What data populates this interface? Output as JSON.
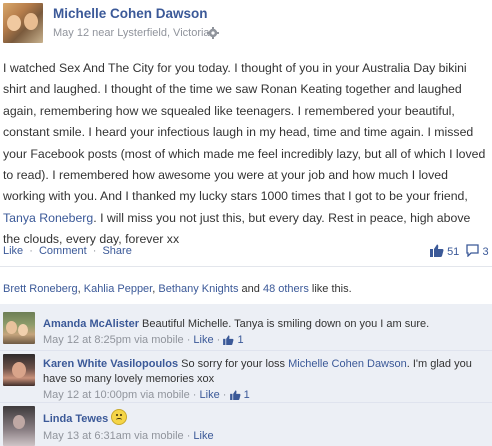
{
  "post": {
    "author": "Michelle Cohen Dawson",
    "date": "May 12",
    "location_prefix": " near ",
    "location": "Lysterfield, Victoria",
    "meta_sep": " · ",
    "privacy_icon": "gear-icon",
    "body_before_tag": "I watched Sex And The City for you today. I thought of you in your Australia Day bikini shirt and laughed. I thought of the time we saw Ronan Keating together and laughed again, remembering how we squealed like teenagers. I remembered your beautiful, constant smile. I heard your infectious laugh in my head, time and time again. I missed your Facebook posts (most of which made me feel incredibly lazy, but all of which I loved to read). I remembered how awesome you were at your job and how much I loved working with you. And I thanked my lucky stars 1000 times that I got to be your friend, ",
    "tagged": "Tanya Roneberg",
    "body_after_tag": ". I will miss you not just this, but every day. Rest in peace, high above the clouds, every day, forever xx",
    "actions": {
      "like": "Like",
      "comment": "Comment",
      "share": "Share",
      "sep": "·"
    },
    "like_count": "51",
    "comment_count": "3",
    "likers": {
      "names": [
        "Brett Roneberg",
        "Kahlia Pepper",
        "Bethany Knights"
      ],
      "and": " and ",
      "others": "48 others",
      "suffix": " like this."
    }
  },
  "comments": [
    {
      "name": "Amanda McAlister",
      "text": "Beautiful Michelle. Tanya is smiling down on you I am sure.",
      "time": "May 12 at 8:25pm via mobile",
      "like_label": "Like",
      "likes": "1"
    },
    {
      "name": "Karen White Vasilopoulos",
      "text_before": "So sorry for your loss ",
      "mention": "Michelle Cohen Dawson",
      "text_after": ". I'm glad you have so many lovely memories xox",
      "time": "May 12 at 10:00pm via mobile",
      "like_label": "Like",
      "likes": "1"
    },
    {
      "name": "Linda Tewes",
      "emoji": "sad-face-icon",
      "time": "May 13 at 6:31am via mobile",
      "like_label": "Like"
    }
  ],
  "colors": {
    "link": "#3b5998",
    "meta": "#90949c",
    "comments_bg": "#eceff5"
  }
}
